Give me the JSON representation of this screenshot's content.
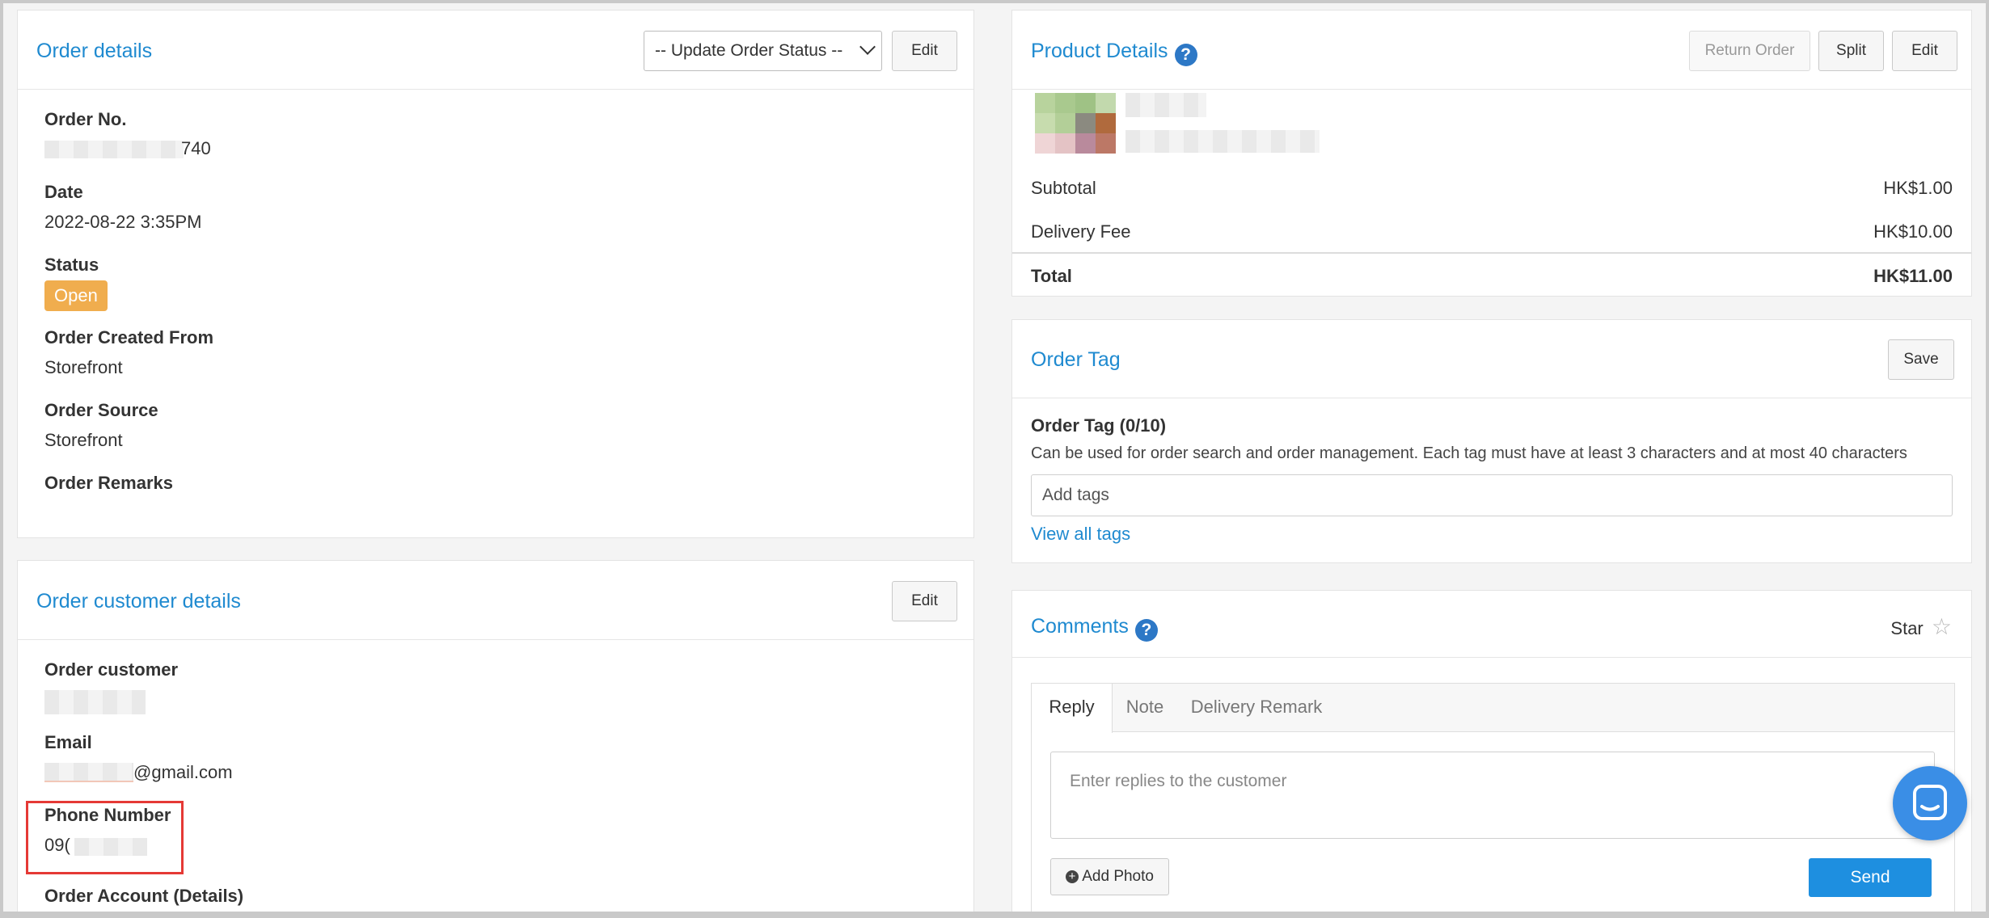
{
  "order_details": {
    "title": "Order details",
    "status_select": "-- Update Order Status --",
    "edit_label": "Edit",
    "fields": {
      "order_no_label": "Order No.",
      "order_no_value": "740",
      "date_label": "Date",
      "date_value": "2022-08-22 3:35PM",
      "status_label": "Status",
      "status_value": "Open",
      "created_from_label": "Order Created From",
      "created_from_value": "Storefront",
      "source_label": "Order Source",
      "source_value": "Storefront",
      "remarks_label": "Order Remarks"
    }
  },
  "customer_details": {
    "title": "Order customer details",
    "edit_label": "Edit",
    "customer_label": "Order customer",
    "email_label": "Email",
    "email_value": "@gmail.com",
    "phone_label": "Phone Number",
    "phone_value": "09(",
    "account_label": "Order Account (Details)"
  },
  "product_details": {
    "title": "Product Details",
    "help_icon": "?",
    "return_label": "Return Order",
    "split_label": "Split",
    "edit_label": "Edit",
    "subtotal_label": "Subtotal",
    "subtotal_value": "HK$1.00",
    "delivery_label": "Delivery Fee",
    "delivery_value": "HK$10.00",
    "total_label": "Total",
    "total_value": "HK$11.00"
  },
  "order_tag": {
    "title": "Order Tag",
    "save_label": "Save",
    "tag_label": "Order Tag (0/10)",
    "description": "Can be used for order search and order management. Each tag must have at least 3 characters and at most 40 characters",
    "input_placeholder": "Add tags",
    "view_all_label": "View all tags"
  },
  "comments": {
    "title": "Comments",
    "help_icon": "?",
    "star_label": "Star",
    "tabs": [
      "Reply",
      "Note",
      "Delivery Remark"
    ],
    "textarea_placeholder": "Enter replies to the customer",
    "add_photo_label": "Add Photo",
    "send_label": "Send"
  },
  "colors": {
    "accent": "#1f8ad0",
    "status_open": "#f0ad4e",
    "send_button": "#1e8fe0",
    "highlight_box": "#e53935",
    "chat_bubble": "#3a8ee6"
  }
}
